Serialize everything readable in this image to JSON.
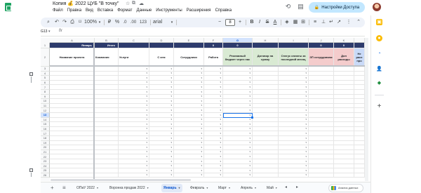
{
  "title": {
    "document": "Копия 💰 2022 ЦУБ \"В точку\"",
    "menu": [
      "Файл",
      "Правка",
      "Вид",
      "Вставка",
      "Формат",
      "Данные",
      "Инструменты",
      "Расширения",
      "Справка"
    ],
    "share_label": "Настройки Доступа"
  },
  "toolbar": {
    "zoom": "100%",
    "currency": "₽",
    "percent": "%",
    "dec_dec": ".0",
    "dec_inc": ".00",
    "number_format": "123",
    "font": "arial",
    "font_size": "8",
    "minus": "−",
    "plus": "+"
  },
  "formula": {
    "name_box": "G13",
    "fx": "fx"
  },
  "grid": {
    "columns": [
      "A",
      "B",
      "C",
      "D",
      "E",
      "F",
      "G",
      "H",
      "I",
      "J",
      "K"
    ],
    "selected_column": "G",
    "row1": {
      "january": "Январь",
      "total": "Итого",
      "f": "0",
      "g": "0",
      "j": "0",
      "k": "0"
    },
    "headers": {
      "a": "Название проекта",
      "b": "Компания",
      "c": "Услуги",
      "d": "С кем",
      "e": "Сотрудники",
      "f": "Работа",
      "g": "Рекламный бюджет через нас",
      "h": "Договор на сумму",
      "i": "Статус оплаты за последний месяц",
      "j": "ЗП сотрудникам",
      "k": "Доп расходы",
      "l": "Не расх про"
    },
    "row_numbers": [
      "1",
      "2",
      "3",
      "4",
      "5",
      "6",
      "7",
      "8",
      "9",
      "10",
      "11",
      "12",
      "13",
      "14",
      "15",
      "16",
      "17",
      "18",
      "19",
      "20",
      "21",
      "22",
      "23",
      "24",
      "25",
      "26"
    ],
    "selected_row": "13",
    "group_toggles": [
      "−",
      "−"
    ],
    "dropdown_glyph": "▾"
  },
  "sheets": {
    "tabs": [
      {
        "label": "ОПиУ 2022",
        "active": false
      },
      {
        "label": "Воронка продаж 2022",
        "active": false
      },
      {
        "label": "Январь",
        "active": true
      },
      {
        "label": "Февраль",
        "active": false
      },
      {
        "label": "Март",
        "active": false
      },
      {
        "label": "Апрель",
        "active": false
      },
      {
        "label": "Май",
        "active": false
      }
    ],
    "add": "+",
    "list": "≡",
    "explore": "Анализ данных"
  },
  "icons": [
    "history-icon",
    "comment-icon",
    "video-icon",
    "share-lock-icon"
  ],
  "colors": {
    "header_fill": "#2d3b6c",
    "green_fill": "#d9ead3",
    "pink_fill": "#f4cccc",
    "blue_fill": "#c9daf8",
    "selection": "#1a73e8"
  }
}
